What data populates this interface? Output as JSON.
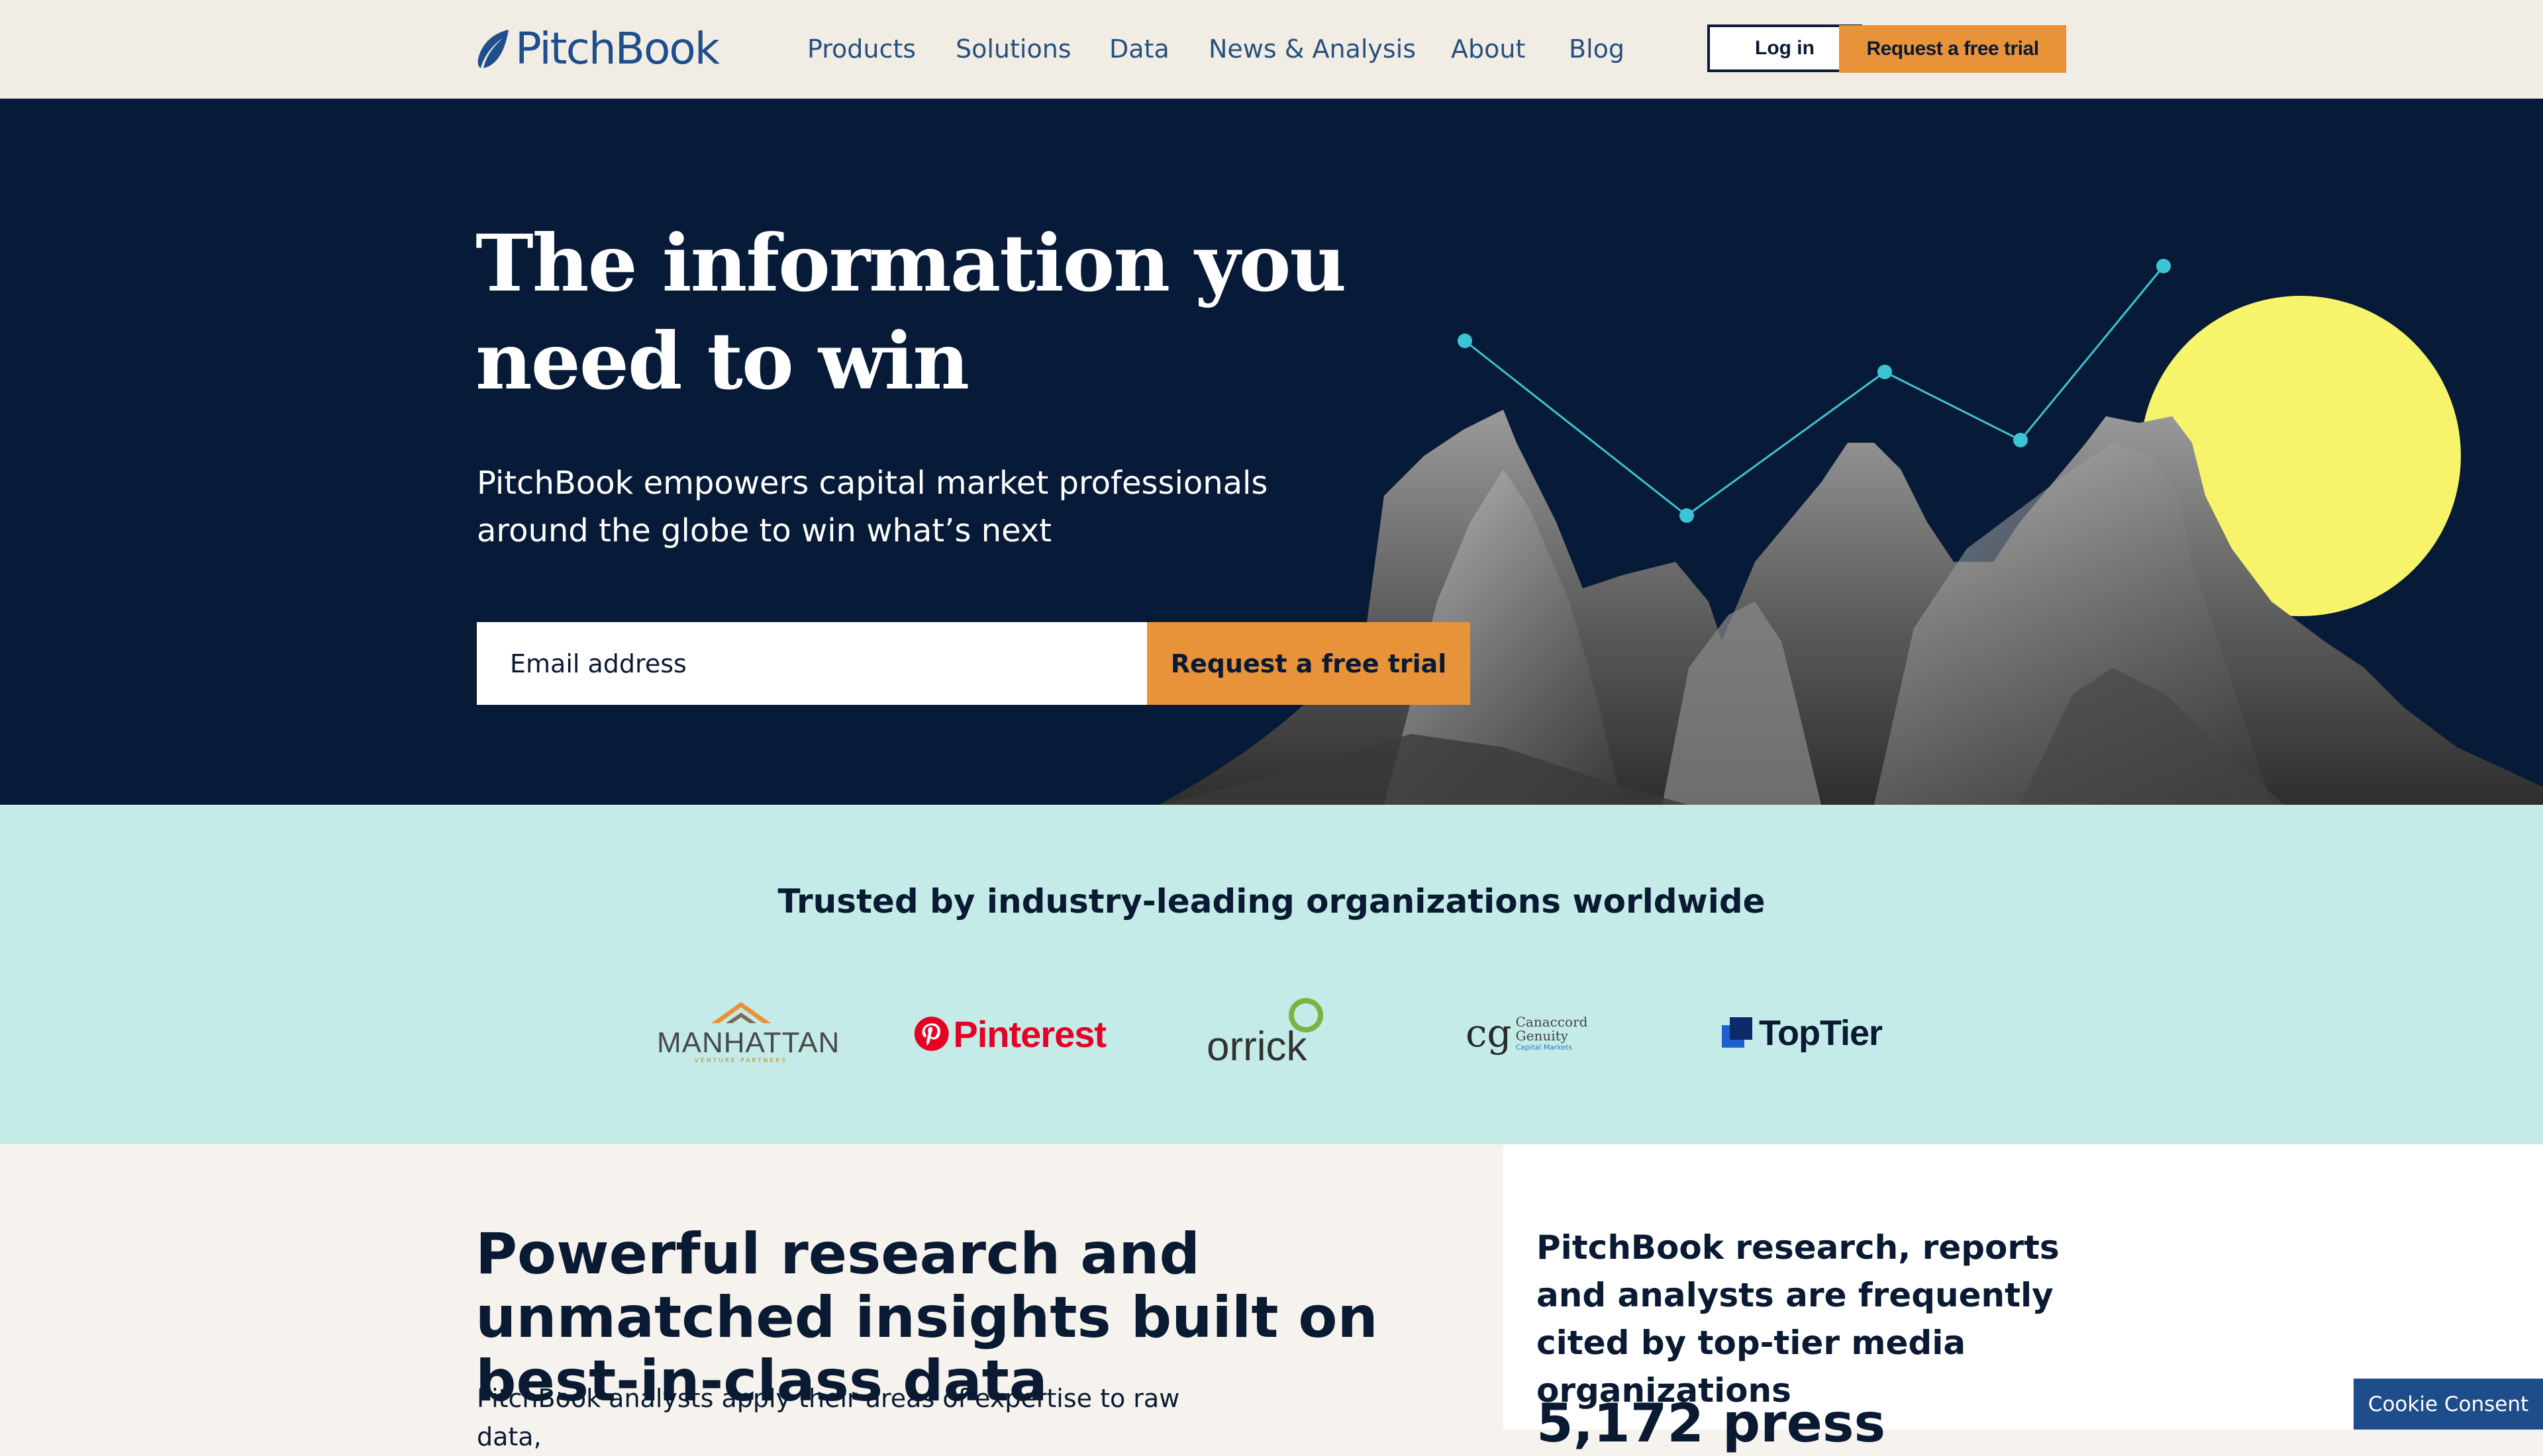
{
  "header": {
    "logo_text": "PitchBook",
    "nav": [
      "Products",
      "Solutions",
      "Data",
      "News & Analysis",
      "About",
      "Blog"
    ],
    "login_label": "Log in",
    "trial_label": "Request a free trial"
  },
  "hero": {
    "title": "The information you need to win",
    "subtitle": "PitchBook empowers capital market professionals around the globe to win what’s next",
    "email_placeholder": "Email address",
    "cta_label": "Request a free trial"
  },
  "trusted": {
    "heading": "Trusted by industry-leading organizations worldwide",
    "logos": [
      {
        "name": "MANHATTAN",
        "sub": "VENTURE PARTNERS"
      },
      {
        "name": "Pinterest"
      },
      {
        "name": "orrick"
      },
      {
        "name": "Canaccord Genuity",
        "mark": "cg",
        "sub": "Capital Markets"
      },
      {
        "name": "TopTier"
      }
    ]
  },
  "research": {
    "heading": "Powerful research and unmatched insights built on best-in-class data",
    "body": "PitchBook analysts apply their areas of expertise to raw data,"
  },
  "media": {
    "heading": "PitchBook research, reports and analysts are frequently cited by top-tier media organizations",
    "stat": "5,172 press"
  },
  "cookie": {
    "label": "Cookie Consent"
  },
  "colors": {
    "accent": "#e8923a",
    "navy": "#071a38",
    "teal": "#c4ebe8",
    "brand_blue": "#1f4e8c",
    "sun": "#f7f36a",
    "chart_line": "#3cc4d4"
  }
}
